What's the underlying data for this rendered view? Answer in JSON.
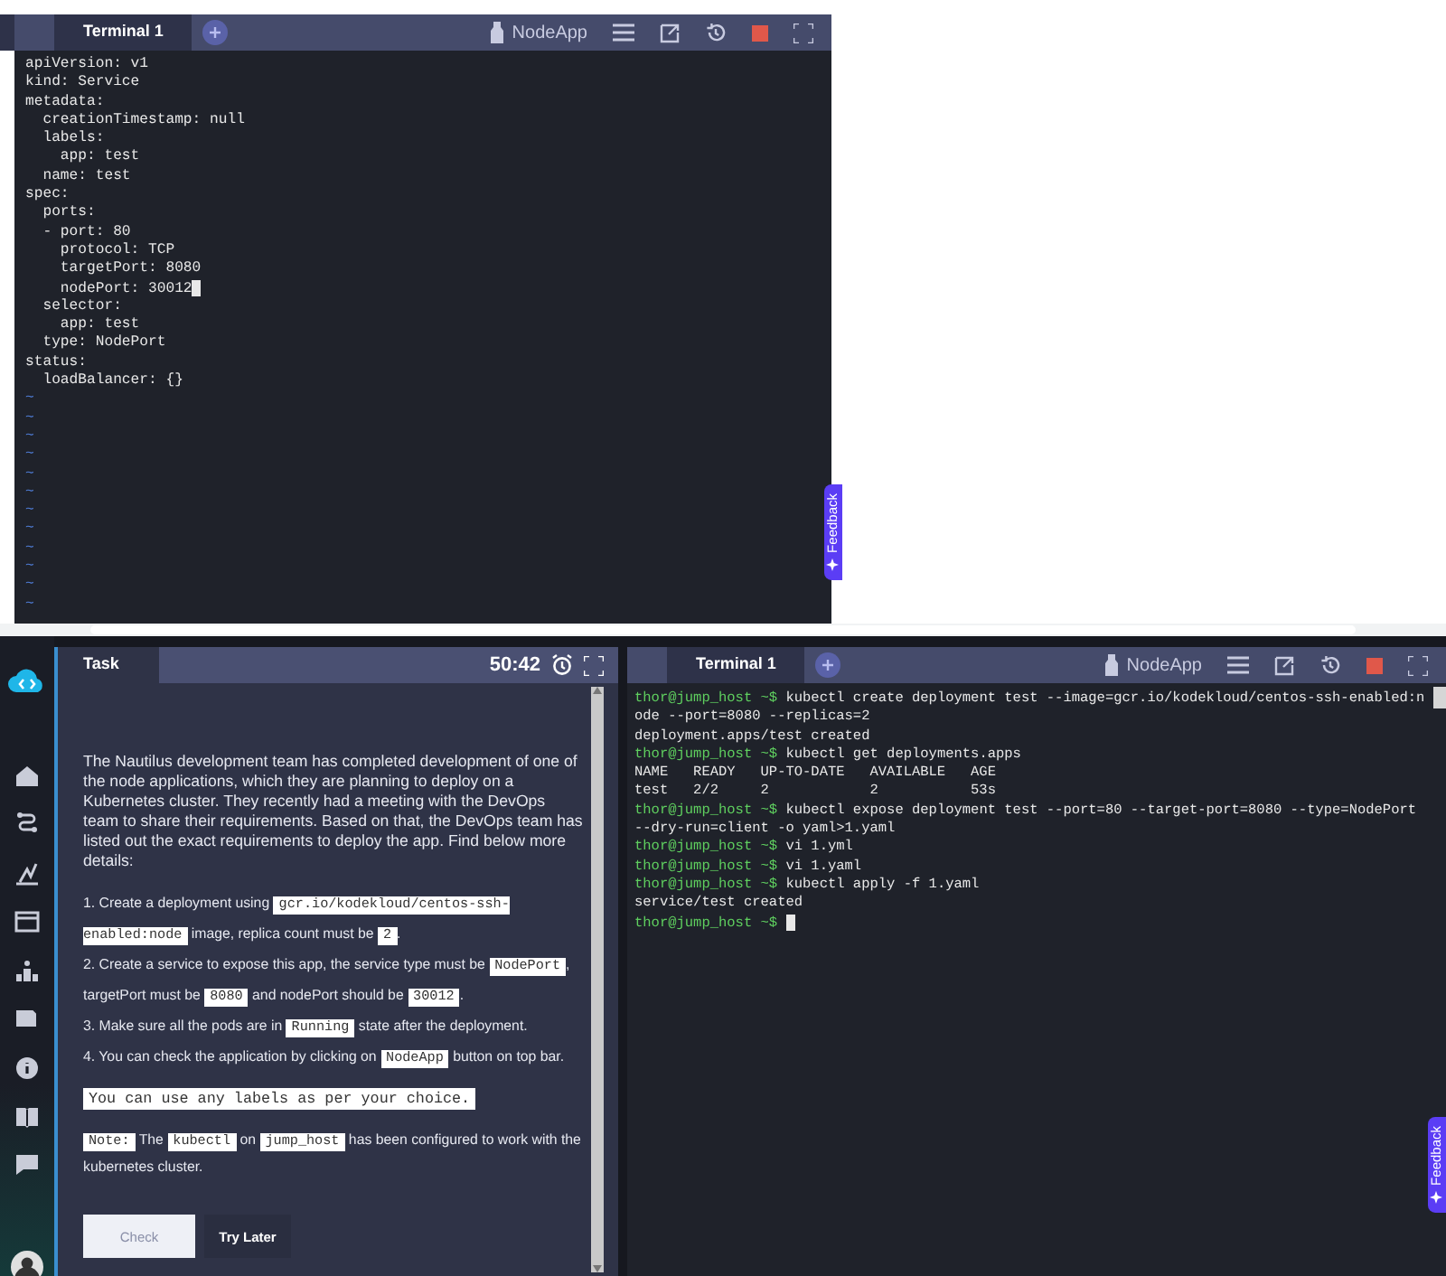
{
  "top_terminal": {
    "tabs": [
      {
        "label": "Terminal 1",
        "selected": true
      }
    ],
    "app_button": "NodeApp",
    "lines": [
      {
        "text": "apiVersion: v1",
        "cursor": false
      },
      {
        "text": "kind: Service",
        "cursor": false
      },
      {
        "text": "metadata:",
        "cursor": false
      },
      {
        "text": "  creationTimestamp: null",
        "cursor": false
      },
      {
        "text": "  labels:",
        "cursor": false
      },
      {
        "text": "    app: test",
        "cursor": false
      },
      {
        "text": "  name: test",
        "cursor": false
      },
      {
        "text": "spec:",
        "cursor": false
      },
      {
        "text": "  ports:",
        "cursor": false
      },
      {
        "text": "  - port: 80",
        "cursor": false
      },
      {
        "text": "    protocol: TCP",
        "cursor": false
      },
      {
        "text": "    targetPort: 8080",
        "cursor": false
      },
      {
        "text": "    nodePort: 30012",
        "cursor": true
      },
      {
        "text": "  selector:",
        "cursor": false
      },
      {
        "text": "    app: test",
        "cursor": false
      },
      {
        "text": "  type: NodePort",
        "cursor": false
      },
      {
        "text": "status:",
        "cursor": false
      },
      {
        "text": "  loadBalancer: {}",
        "cursor": false
      }
    ],
    "empty_line_markers": [
      "~",
      "~",
      "~",
      "~",
      "~",
      "~",
      "~",
      "~",
      "~",
      "~",
      "~",
      "~"
    ]
  },
  "top_feedback": {
    "label": "Feedback"
  },
  "task_panel": {
    "title": "Task",
    "timer": "50:42",
    "intro": "The Nautilus development team has completed development of one of the node applications, which they are planning to deploy on a Kubernetes cluster. They recently had a meeting with the DevOps team to share their requirements. Based on that, the DevOps team has listed out the exact requirements to deploy the app. Find below more details:",
    "steps": [
      {
        "number": "1.",
        "segments": [
          {
            "kind": "text",
            "text": "Create a deployment using "
          },
          {
            "kind": "code",
            "text": "gcr.io/kodekloud/centos-ssh-enabled:node"
          },
          {
            "kind": "text",
            "text": " image, replica count must be "
          },
          {
            "kind": "code",
            "text": "2"
          },
          {
            "kind": "text",
            "text": "."
          }
        ]
      },
      {
        "number": "2.",
        "segments": [
          {
            "kind": "text",
            "text": "Create a service to expose this app, the service type must be "
          },
          {
            "kind": "code",
            "text": "NodePort"
          },
          {
            "kind": "text",
            "text": ", targetPort must be "
          },
          {
            "kind": "code",
            "text": "8080"
          },
          {
            "kind": "text",
            "text": " and nodePort should be "
          },
          {
            "kind": "code",
            "text": "30012"
          },
          {
            "kind": "text",
            "text": "."
          }
        ]
      },
      {
        "number": "3.",
        "segments": [
          {
            "kind": "text",
            "text": "Make sure all the pods are in "
          },
          {
            "kind": "code",
            "text": "Running"
          },
          {
            "kind": "text",
            "text": " state after the deployment."
          }
        ]
      },
      {
        "number": "4.",
        "segments": [
          {
            "kind": "text",
            "text": "You can check the application by clicking on "
          },
          {
            "kind": "code",
            "text": "NodeApp"
          },
          {
            "kind": "text",
            "text": " button on top bar."
          }
        ]
      }
    ],
    "tip": [
      {
        "kind": "code",
        "text": "You can use any labels as per your choice."
      }
    ],
    "note": [
      {
        "kind": "code",
        "text": "Note:"
      },
      {
        "kind": "text",
        "text": " The "
      },
      {
        "kind": "code",
        "text": "kubectl"
      },
      {
        "kind": "text",
        "text": " on "
      },
      {
        "kind": "code",
        "text": "jump_host"
      },
      {
        "kind": "text",
        "text": " has been configured to work with the kubernetes cluster."
      }
    ],
    "buttons": [
      {
        "label": "Check",
        "kind": "light"
      },
      {
        "label": "Try Later",
        "kind": "dark"
      }
    ]
  },
  "bottom_terminal": {
    "tabs": [
      {
        "label": "Terminal 1",
        "selected": true
      }
    ],
    "app_button": "NodeApp",
    "lines": [
      {
        "prompt": "thor@jump_host ~$",
        "text": " kubectl create deployment test --image=gcr.io/kodekloud/centos-ssh-enabled:n",
        "cursor": false
      },
      {
        "text": "ode --port=8080 --replicas=2",
        "cursor": false
      },
      {
        "text": "deployment.apps/test created",
        "cursor": false
      },
      {
        "prompt": "thor@jump_host ~$",
        "text": " kubectl get deployments.apps",
        "cursor": false
      },
      {
        "text": "NAME   READY   UP-TO-DATE   AVAILABLE   AGE",
        "cursor": false
      },
      {
        "text": "test   2/2     2            2           53s",
        "cursor": false
      },
      {
        "prompt": "thor@jump_host ~$",
        "text": " kubectl expose deployment test --port=80 --target-port=8080 --type=NodePort",
        "cursor": false
      },
      {
        "text": "--dry-run=client -o yaml>1.yaml",
        "cursor": false
      },
      {
        "prompt": "thor@jump_host ~$",
        "text": " vi 1.yml",
        "cursor": false
      },
      {
        "prompt": "thor@jump_host ~$",
        "text": " vi 1.yaml",
        "cursor": false
      },
      {
        "prompt": "thor@jump_host ~$",
        "text": " kubectl apply -f 1.yaml",
        "cursor": false
      },
      {
        "text": "service/test created",
        "cursor": false
      },
      {
        "prompt": "thor@jump_host ~$",
        "cursor": true
      }
    ]
  },
  "bottom_feedback": {
    "label": "Feedback"
  }
}
